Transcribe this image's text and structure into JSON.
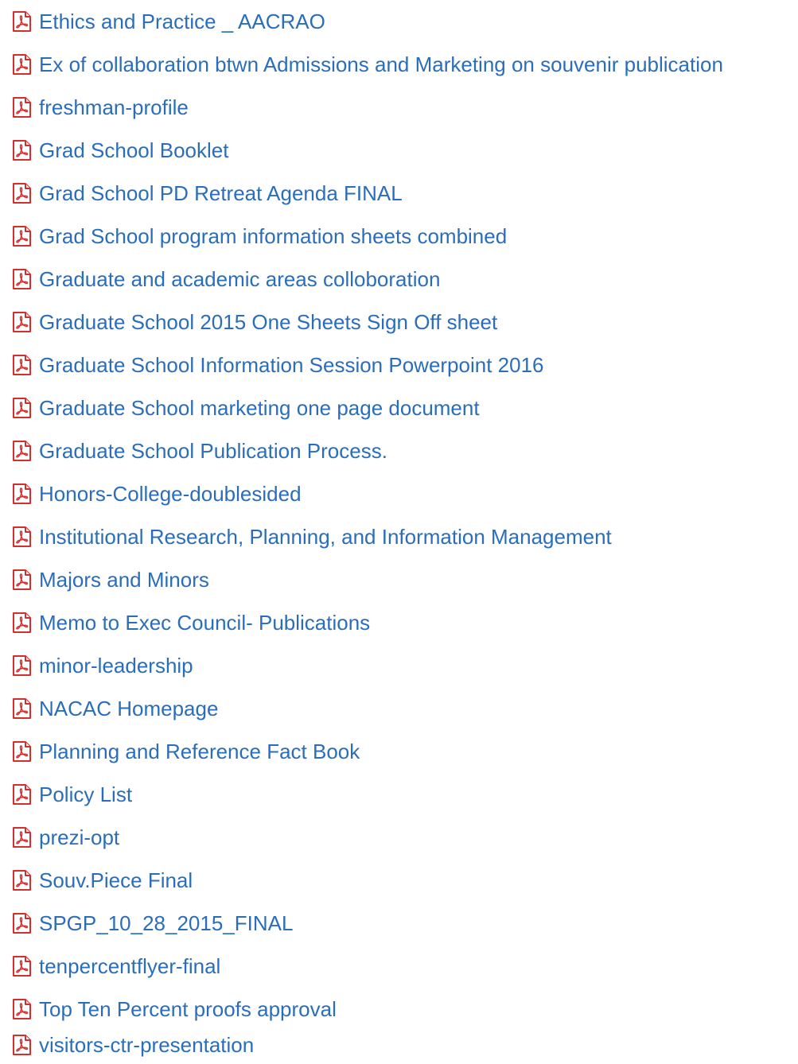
{
  "files": [
    {
      "label": "Ethics and Practice _ AACRAO",
      "icon": "pdf-icon"
    },
    {
      "label": "Ex of collaboration btwn Admissions and Marketing on souvenir publication",
      "icon": "pdf-icon"
    },
    {
      "label": "freshman-profile",
      "icon": "pdf-icon"
    },
    {
      "label": "Grad School Booklet",
      "icon": "pdf-icon"
    },
    {
      "label": "Grad School PD Retreat Agenda FINAL",
      "icon": "pdf-icon"
    },
    {
      "label": "Grad School program information sheets combined",
      "icon": "pdf-icon"
    },
    {
      "label": "Graduate and academic areas colloboration",
      "icon": "pdf-icon"
    },
    {
      "label": "Graduate School 2015 One Sheets Sign Off sheet",
      "icon": "pdf-icon"
    },
    {
      "label": "Graduate School Information Session Powerpoint 2016",
      "icon": "pdf-icon"
    },
    {
      "label": "Graduate School marketing one page document",
      "icon": "pdf-icon"
    },
    {
      "label": "Graduate School Publication Process.",
      "icon": "pdf-icon"
    },
    {
      "label": "Honors-College-doublesided",
      "icon": "pdf-icon"
    },
    {
      "label": "Institutional Research, Planning, and Information Management",
      "icon": "pdf-icon"
    },
    {
      "label": "Majors and Minors",
      "icon": "pdf-icon"
    },
    {
      "label": "Memo to Exec Council- Publications",
      "icon": "pdf-icon"
    },
    {
      "label": "minor-leadership",
      "icon": "pdf-icon"
    },
    {
      "label": "NACAC Homepage",
      "icon": "pdf-icon"
    },
    {
      "label": "Planning and Reference Fact Book",
      "icon": "pdf-icon"
    },
    {
      "label": "Policy List",
      "icon": "pdf-icon"
    },
    {
      "label": "prezi-opt",
      "icon": "pdf-icon"
    },
    {
      "label": "Souv.Piece Final",
      "icon": "pdf-icon"
    },
    {
      "label": "SPGP_10_28_2015_FINAL",
      "icon": "pdf-icon"
    },
    {
      "label": "tenpercentflyer-final",
      "icon": "pdf-icon"
    },
    {
      "label": "Top Ten Percent proofs approval",
      "icon": "pdf-icon"
    },
    {
      "label": "visitors-ctr-presentation",
      "icon": "pdf-icon"
    }
  ],
  "colors": {
    "link": "#2a6ebb",
    "icon_red": "#d32f2f",
    "background": "#ffffff"
  }
}
